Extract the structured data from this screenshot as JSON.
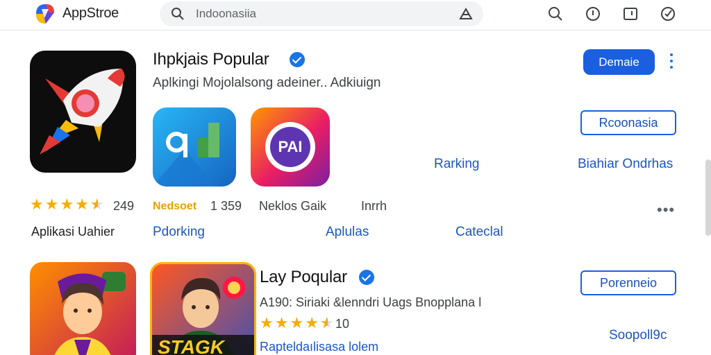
{
  "app": {
    "brand": "AppStroe"
  },
  "search": {
    "query": "Indoonasiia"
  },
  "section1": {
    "title": "Ihpkjais Popular",
    "subtitle": "Aplkingi Mojolalsong adeiner.. Adkiuign",
    "primary_button": "Demaie",
    "outline_button": "Rcoonasia",
    "ranking_label": "Rarking",
    "right_link": "Biahiar Ondrhas",
    "rating_count": "249",
    "tile1_label": "Nedsoet",
    "tile1_count": "1 359",
    "tile2_label": "Neklos Gaik",
    "tile3_label": "Inrrh",
    "tile2_badge": "PAI",
    "bottom_left": "Aplikasi Uahier",
    "links": [
      "Pdorking",
      "Aplulas",
      "Cateclal"
    ]
  },
  "section2": {
    "title": "Lay Poqular",
    "subtitle": "A190: Siriaki &lenndri Uags Bnopplana l",
    "rating_count": "10",
    "outline_button": "Porenneio",
    "right_link": "Soopoll9c",
    "bottom_link": "Rapteldaılisasa lolem",
    "tile2_banner": "STAGK"
  },
  "ratings": {
    "hero": 4.5,
    "section2": 4.5
  },
  "colors": {
    "accent": "#1a5fe0",
    "link": "#1a56c4",
    "star": "#f9ab00"
  }
}
